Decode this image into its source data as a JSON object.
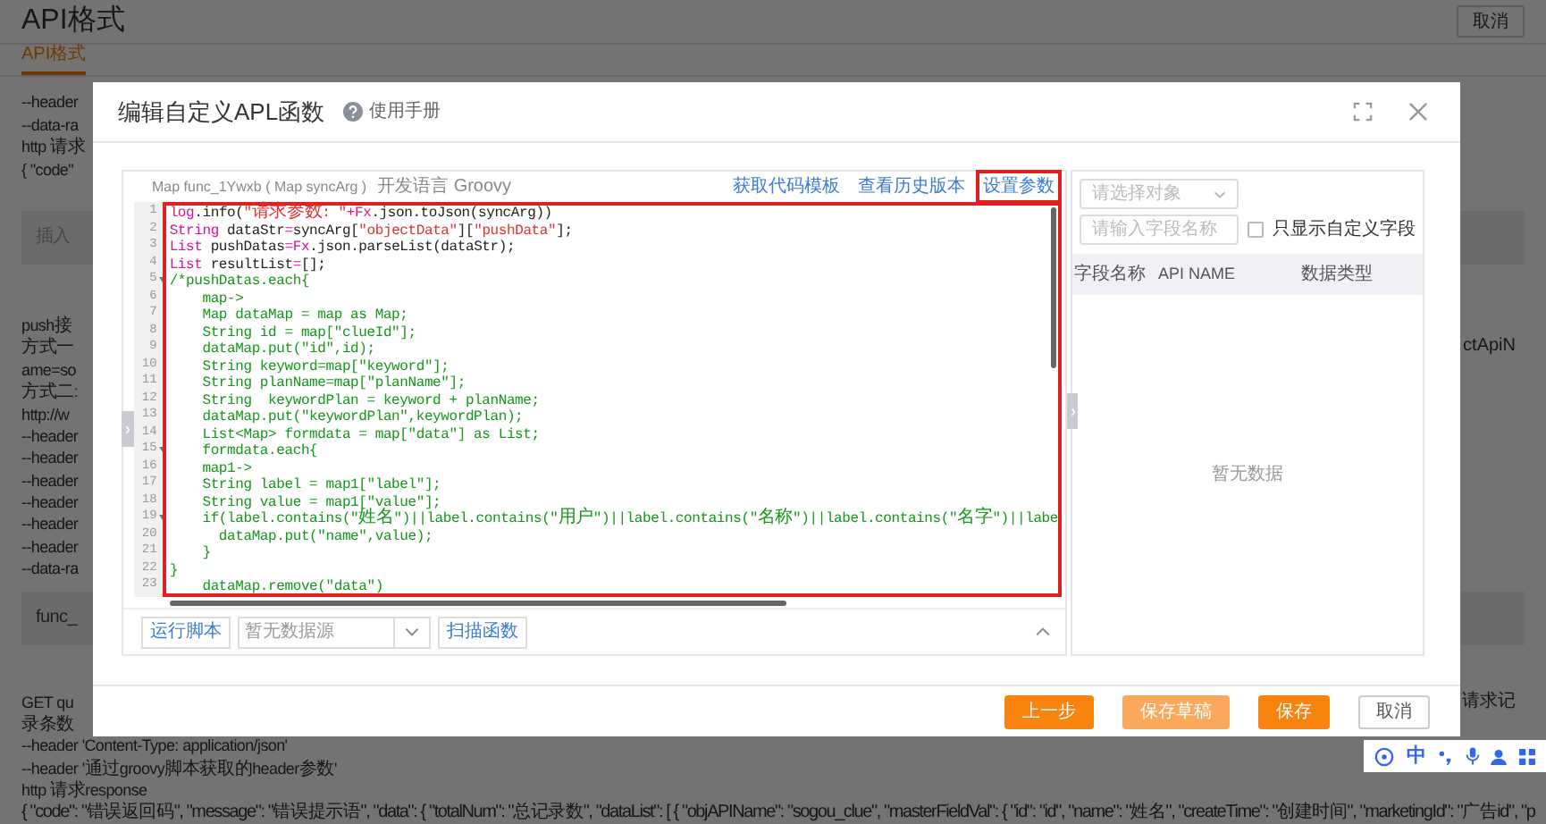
{
  "page": {
    "title": "API格式",
    "cancel_button": "取消",
    "tabs": [
      {
        "label": "API格式",
        "selected": true
      }
    ],
    "lines": [
      {
        "kind": "text",
        "left": "--header"
      },
      {
        "kind": "text",
        "left": "--data-ra"
      },
      {
        "kind": "text",
        "left": "http 请求"
      },
      {
        "kind": "text",
        "left": "{ \"code\""
      },
      {
        "kind": "field",
        "left": "插入"
      },
      {
        "kind": "text",
        "left": "push接"
      },
      {
        "kind": "text",
        "left": "方式一",
        "right": "ctApiN"
      },
      {
        "kind": "text",
        "left": "ame=so"
      },
      {
        "kind": "text",
        "left": "方式二:"
      },
      {
        "kind": "text",
        "left": "http://w"
      },
      {
        "kind": "text",
        "left": "--header"
      },
      {
        "kind": "text",
        "left": "--header"
      },
      {
        "kind": "text",
        "left": "--header"
      },
      {
        "kind": "text",
        "left": "--header"
      },
      {
        "kind": "text",
        "left": "--header"
      },
      {
        "kind": "text",
        "left": "--header"
      },
      {
        "kind": "text",
        "left": "--data-ra"
      },
      {
        "kind": "code",
        "left": "func_"
      },
      {
        "kind": "text",
        "left": "GET qu",
        "right": "请求记"
      },
      {
        "kind": "text",
        "left": "录条数"
      },
      {
        "kind": "text",
        "left": "--header 'Content-Type: application/json'"
      },
      {
        "kind": "text",
        "left": "--header '通过groovy脚本获取的header参数'"
      },
      {
        "kind": "text",
        "left": "http 请求response"
      },
      {
        "kind": "text",
        "left": "{ \"code\": \"错误返回码\", \"message\": \"错误提示语\", \"data\": { \"totalNum\": \"总记录数\", \"dataList\": [ { \"objAPIName\": \"sogou_clue\", \"masterFieldVal\": { \"id\": \"id\", \"name\": \"姓名\", \"createTime\": \"创建时间\", \"marketingId\": \"广告id\", \"p"
      }
    ]
  },
  "dialog": {
    "title": "编辑自定义APL函数",
    "help_link": "使用手册",
    "editor": {
      "signature": "Map func_1Ywxb ( Map syncArg )",
      "language": "开发语言 Groovy",
      "highlighted": true,
      "links": [
        {
          "label": "获取代码模板",
          "highlighted": false
        },
        {
          "label": "查看历史版本",
          "highlighted": false
        },
        {
          "label": "设置参数",
          "highlighted": true
        }
      ],
      "lines": [
        {
          "number": "1",
          "foldable": false,
          "tokens": [
            {
              "kind": "keyword",
              "text": "log"
            },
            {
              "kind": "plain",
              "text": ".info("
            },
            {
              "kind": "string",
              "text": "\"请求参数: \""
            },
            {
              "kind": "keyword",
              "text": "+Fx"
            },
            {
              "kind": "plain",
              "text": ".json.toJson(syncArg))"
            }
          ]
        },
        {
          "number": "2",
          "foldable": false,
          "tokens": [
            {
              "kind": "keyword",
              "text": "String"
            },
            {
              "kind": "plain",
              "text": " dataStr"
            },
            {
              "kind": "keyword",
              "text": "="
            },
            {
              "kind": "plain",
              "text": "syncArg["
            },
            {
              "kind": "string",
              "text": "\"objectData\""
            },
            {
              "kind": "plain",
              "text": "]["
            },
            {
              "kind": "string",
              "text": "\"pushData\""
            },
            {
              "kind": "plain",
              "text": "];"
            }
          ]
        },
        {
          "number": "3",
          "foldable": false,
          "tokens": [
            {
              "kind": "keyword",
              "text": "List"
            },
            {
              "kind": "plain",
              "text": " pushDatas"
            },
            {
              "kind": "keyword",
              "text": "=Fx"
            },
            {
              "kind": "plain",
              "text": ".json.parseList(dataStr);"
            }
          ]
        },
        {
          "number": "4",
          "foldable": false,
          "tokens": [
            {
              "kind": "keyword",
              "text": "List"
            },
            {
              "kind": "plain",
              "text": " resultList"
            },
            {
              "kind": "keyword",
              "text": "="
            },
            {
              "kind": "plain",
              "text": "[];"
            }
          ]
        },
        {
          "number": "5",
          "foldable": true,
          "tokens": [
            {
              "kind": "comment",
              "text": "/*pushDatas.each{"
            }
          ]
        },
        {
          "number": "6",
          "foldable": false,
          "tokens": [
            {
              "kind": "comment",
              "text": "    map->"
            }
          ]
        },
        {
          "number": "7",
          "foldable": false,
          "tokens": [
            {
              "kind": "comment",
              "text": "    Map dataMap = map as Map;"
            }
          ]
        },
        {
          "number": "8",
          "foldable": false,
          "tokens": [
            {
              "kind": "comment",
              "text": "    String id = map[\"clueId\"];"
            }
          ]
        },
        {
          "number": "9",
          "foldable": false,
          "tokens": [
            {
              "kind": "comment",
              "text": "    dataMap.put(\"id\",id);"
            }
          ]
        },
        {
          "number": "10",
          "foldable": false,
          "tokens": [
            {
              "kind": "comment",
              "text": "    String keyword=map[\"keyword\"];"
            }
          ]
        },
        {
          "number": "11",
          "foldable": false,
          "tokens": [
            {
              "kind": "comment",
              "text": "    String planName=map[\"planName\"];"
            }
          ]
        },
        {
          "number": "12",
          "foldable": false,
          "tokens": [
            {
              "kind": "comment",
              "text": "    String  keywordPlan = keyword + planName;"
            }
          ]
        },
        {
          "number": "13",
          "foldable": false,
          "tokens": [
            {
              "kind": "comment",
              "text": "    dataMap.put(\"keywordPlan\",keywordPlan);"
            }
          ]
        },
        {
          "number": "14",
          "foldable": false,
          "tokens": [
            {
              "kind": "comment",
              "text": "    List<Map> formdata = map[\"data\"] as List;"
            }
          ]
        },
        {
          "number": "15",
          "foldable": true,
          "tokens": [
            {
              "kind": "comment",
              "text": "    formdata.each{"
            }
          ]
        },
        {
          "number": "16",
          "foldable": false,
          "tokens": [
            {
              "kind": "comment",
              "text": "    map1->"
            }
          ]
        },
        {
          "number": "17",
          "foldable": false,
          "tokens": [
            {
              "kind": "comment",
              "text": "    String label = map1[\"label\"];"
            }
          ]
        },
        {
          "number": "18",
          "foldable": false,
          "tokens": [
            {
              "kind": "comment",
              "text": "    String value = map1[\"value\"];"
            }
          ]
        },
        {
          "number": "19",
          "foldable": true,
          "tokens": [
            {
              "kind": "comment",
              "text": "    if(label.contains(\"姓名\")||label.contains(\"用户\")||label.contains(\"名称\")||label.contains(\"名字\")||labe"
            }
          ]
        },
        {
          "number": "20",
          "foldable": false,
          "tokens": [
            {
              "kind": "comment",
              "text": "      dataMap.put(\"name\",value);"
            }
          ]
        },
        {
          "number": "21",
          "foldable": false,
          "tokens": [
            {
              "kind": "comment",
              "text": "    }"
            }
          ]
        },
        {
          "number": "22",
          "foldable": false,
          "tokens": [
            {
              "kind": "comment",
              "text": "}"
            }
          ]
        },
        {
          "number": "23",
          "foldable": false,
          "tokens": [
            {
              "kind": "comment",
              "text": "    dataMap.remove(\"data\")"
            }
          ]
        }
      ],
      "run_button": "运行脚本",
      "datasource_placeholder": "暂无数据源",
      "scan_button": "扫描函数"
    },
    "fields_panel": {
      "object_placeholder": "请选择对象",
      "field_placeholder": "请输入字段名称",
      "custom_only": {
        "label": "只显示自定义字段",
        "checked": false
      },
      "columns": [
        "字段名称",
        "API NAME",
        "数据类型"
      ],
      "empty_text": "暂无数据"
    },
    "buttons": [
      {
        "label": "上一步",
        "kind": "primary"
      },
      {
        "label": "保存草稿",
        "kind": "light"
      },
      {
        "label": "保存",
        "kind": "primary"
      },
      {
        "label": "取消",
        "kind": "plain"
      }
    ]
  },
  "ime_toolbar": {
    "mode": "中"
  }
}
